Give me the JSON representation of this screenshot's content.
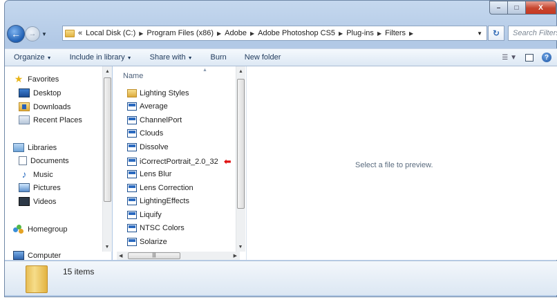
{
  "window": {
    "caption_min": "–",
    "caption_max": "□",
    "caption_close": "X"
  },
  "address": {
    "prefix": "«",
    "crumbs": [
      "Local Disk (C:)",
      "Program Files (x86)",
      "Adobe",
      "Adobe Photoshop CS5",
      "Plug-ins",
      "Filters"
    ],
    "search_placeholder": "Search Filters"
  },
  "toolbar": {
    "organize": "Organize",
    "include_in_library": "Include in library",
    "share_with": "Share with",
    "burn": "Burn",
    "new_folder": "New folder"
  },
  "nav": {
    "favorites": "Favorites",
    "desktop": "Desktop",
    "downloads": "Downloads",
    "recent_places": "Recent Places",
    "libraries": "Libraries",
    "documents": "Documents",
    "music": "Music",
    "pictures": "Pictures",
    "videos": "Videos",
    "homegroup": "Homegroup",
    "computer": "Computer"
  },
  "file_list": {
    "column_name": "Name",
    "items": [
      {
        "name": "Lighting Styles",
        "type": "folder"
      },
      {
        "name": "Average",
        "type": "plugin"
      },
      {
        "name": "ChannelPort",
        "type": "plugin"
      },
      {
        "name": "Clouds",
        "type": "plugin"
      },
      {
        "name": "Dissolve",
        "type": "plugin"
      },
      {
        "name": "iCorrectPortrait_2.0_32",
        "type": "plugin",
        "highlighted": true
      },
      {
        "name": "Lens Blur",
        "type": "plugin"
      },
      {
        "name": "Lens Correction",
        "type": "plugin"
      },
      {
        "name": "LightingEffects",
        "type": "plugin"
      },
      {
        "name": "Liquify",
        "type": "plugin"
      },
      {
        "name": "NTSC Colors",
        "type": "plugin"
      },
      {
        "name": "Solarize",
        "type": "plugin"
      }
    ]
  },
  "preview": {
    "message": "Select a file to preview."
  },
  "details": {
    "item_count": "15 items"
  },
  "colors": {
    "accent": "#2a6ac0",
    "arrow_marker": "#e01010"
  }
}
